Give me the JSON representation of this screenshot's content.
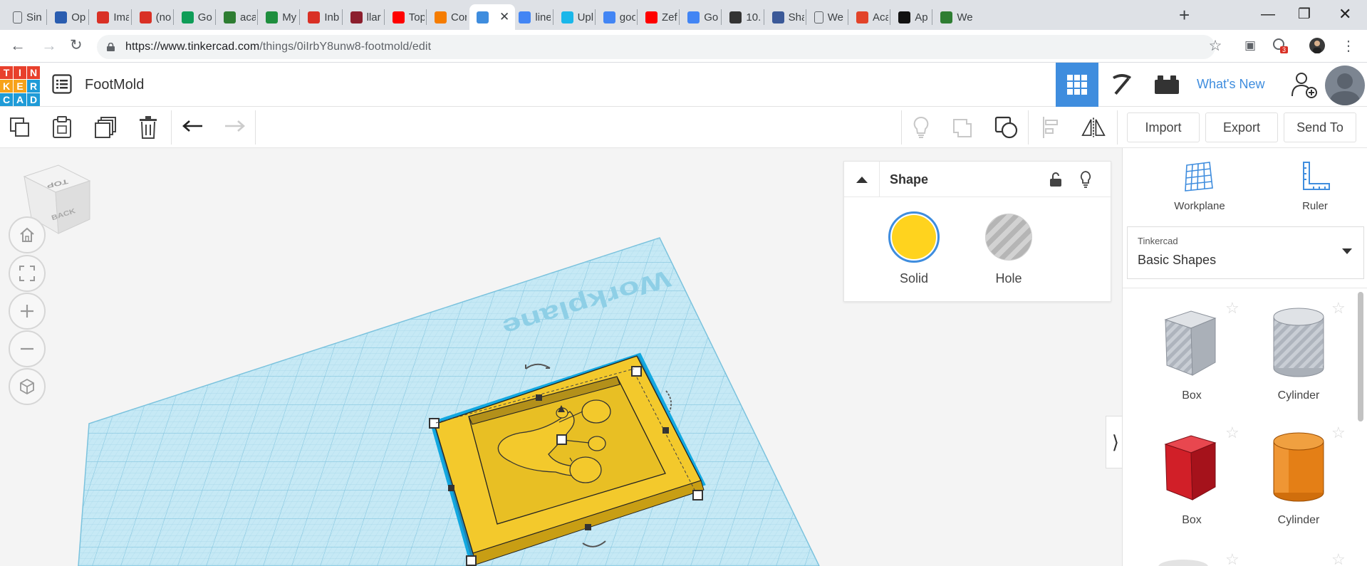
{
  "browser": {
    "tabs": [
      {
        "label": "Sin",
        "icon": "document-icon",
        "color": "#5f6368"
      },
      {
        "label": "Op",
        "icon": "stripes-icon",
        "color": "#2a5db0"
      },
      {
        "label": "Ima",
        "icon": "ic-logo-icon",
        "color": "#d93025"
      },
      {
        "label": "(no",
        "icon": "gmail-icon",
        "color": "#d93025"
      },
      {
        "label": "Go",
        "icon": "hangouts-icon",
        "color": "#0f9d58"
      },
      {
        "label": "aca",
        "icon": "cube-green-icon",
        "color": "#2e7d32"
      },
      {
        "label": "My",
        "icon": "drive-icon",
        "color": "#1e8e3e"
      },
      {
        "label": "Inb",
        "icon": "gmail-icon",
        "color": "#d93025"
      },
      {
        "label": "llar",
        "icon": "bars-icon",
        "color": "#8b1e2d"
      },
      {
        "label": "Top",
        "icon": "youtube-icon",
        "color": "#ff0000"
      },
      {
        "label": "Cor",
        "icon": "blogger-icon",
        "color": "#f57c00"
      },
      {
        "label": "",
        "icon": "tinkercad-icon",
        "color": "#3f8dde"
      },
      {
        "label": "line",
        "icon": "google-icon",
        "color": "#4285f4"
      },
      {
        "label": "Upl",
        "icon": "vimeo-icon",
        "color": "#1ab7ea"
      },
      {
        "label": "goo",
        "icon": "google-icon",
        "color": "#4285f4"
      },
      {
        "label": "Zef",
        "icon": "youtube-icon",
        "color": "#ff0000"
      },
      {
        "label": "Go",
        "icon": "google-icon",
        "color": "#4285f4"
      },
      {
        "label": "10.",
        "icon": "book-icon",
        "color": "#333333"
      },
      {
        "label": "Sha",
        "icon": "facebook-icon",
        "color": "#3b5998"
      },
      {
        "label": "We",
        "icon": "document-icon",
        "color": "#5f6368"
      },
      {
        "label": "Aca",
        "icon": "gitlab-icon",
        "color": "#e24329"
      },
      {
        "label": "Ap",
        "icon": "black-square-icon",
        "color": "#111111"
      },
      {
        "label": "We",
        "icon": "globe-icon",
        "color": "#2e7d32"
      }
    ],
    "url_host": "https://www.tinkercad.com",
    "url_path": "/things/0iIrbY8unw8-footmold/edit",
    "extension_badge": "3"
  },
  "app": {
    "logo_letters": [
      "T",
      "I",
      "N",
      "K",
      "E",
      "R",
      "C",
      "A",
      "D"
    ],
    "logo_colors": [
      "#e8402c",
      "#e8402c",
      "#e8402c",
      "#f7a21b",
      "#f7a21b",
      "#1f9bd7",
      "#1f9bd7",
      "#1f9bd7",
      "#1f9bd7"
    ],
    "project_title": "FootMold",
    "whats_new": "What's New",
    "accent": "#3f8dde"
  },
  "toolbar": {
    "import": "Import",
    "export": "Export",
    "send_to": "Send To"
  },
  "viewcube": {
    "top": "TOP",
    "back": "BACK"
  },
  "canvas": {
    "workplane_label": "Workplane",
    "object_color": "#f5cd2f",
    "grid_color": "#a6d9ec"
  },
  "shape_panel": {
    "title": "Shape",
    "solid_label": "Solid",
    "hole_label": "Hole",
    "solid_color": "#ffd31e"
  },
  "sidebar": {
    "workplane": "Workplane",
    "ruler": "Ruler",
    "library_source": "Tinkercad",
    "library_name": "Basic Shapes",
    "shapes": [
      {
        "name": "Box",
        "kind": "hole-box"
      },
      {
        "name": "Cylinder",
        "kind": "hole-cylinder"
      },
      {
        "name": "Box",
        "kind": "red-box"
      },
      {
        "name": "Cylinder",
        "kind": "orange-cylinder"
      }
    ]
  }
}
